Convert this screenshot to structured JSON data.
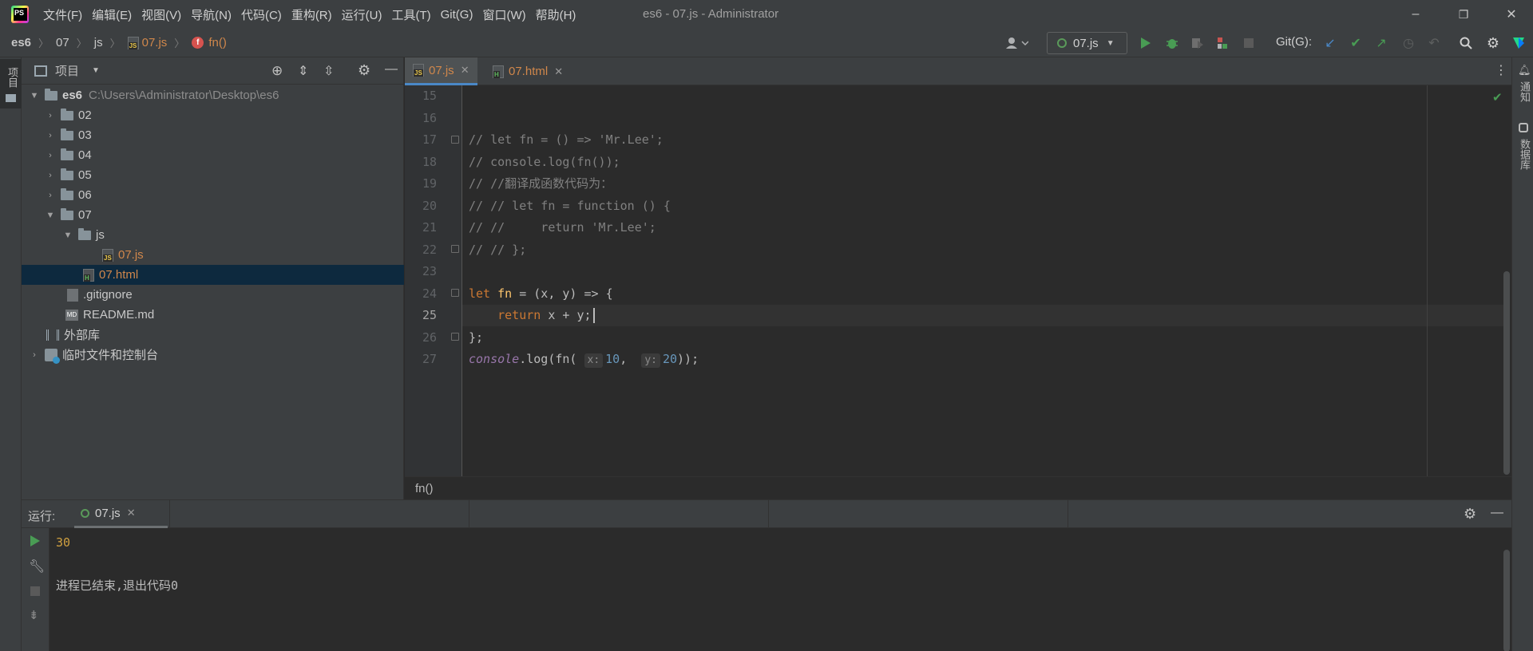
{
  "window": {
    "title": "es6 - 07.js - Administrator",
    "menu": [
      "文件(F)",
      "编辑(E)",
      "视图(V)",
      "导航(N)",
      "代码(C)",
      "重构(R)",
      "运行(U)",
      "工具(T)",
      "Git(G)",
      "窗口(W)",
      "帮助(H)"
    ],
    "controls": {
      "minimize": "–",
      "restore": "❐",
      "close": "✕"
    }
  },
  "navbar": {
    "crumbs": [
      "es6",
      "js",
      "07.js",
      "fn()"
    ],
    "crumb_mid": "07",
    "run_config": "07.js",
    "git_label": "Git(G):",
    "icons": [
      "user-icon",
      "run-icon",
      "debug-icon",
      "coverage-icon",
      "profile-icon",
      "stop-icon",
      "git-update-icon",
      "git-commit-icon",
      "git-push-icon",
      "history-icon",
      "rollback-icon",
      "search-icon",
      "settings-icon",
      "toolbox-icon"
    ]
  },
  "left_strip": {
    "project_label": "项目"
  },
  "project": {
    "title": "项目",
    "root": {
      "name": "es6",
      "path": "C:\\Users\\Administrator\\Desktop\\es6"
    },
    "items": [
      {
        "name": "02"
      },
      {
        "name": "03"
      },
      {
        "name": "04"
      },
      {
        "name": "05"
      },
      {
        "name": "06"
      },
      {
        "name": "07"
      },
      {
        "name": "js"
      },
      {
        "name": "07.js"
      },
      {
        "name": "07.html"
      },
      {
        "name": ".gitignore"
      },
      {
        "name": "README.md"
      },
      {
        "name": "外部库"
      },
      {
        "name": "临时文件和控制台"
      }
    ]
  },
  "editor": {
    "tabs": [
      {
        "label": "07.js",
        "active": true
      },
      {
        "label": "07.html",
        "active": false
      }
    ],
    "line_numbers": [
      "15",
      "16",
      "17",
      "18",
      "19",
      "20",
      "21",
      "22",
      "23",
      "24",
      "25",
      "26",
      "27"
    ],
    "code": {
      "l17": "// let fn = () => 'Mr.Lee';",
      "l18": "// console.log(fn());",
      "l19": "// //翻译成函数代码为：",
      "l20": "// // let fn = function () {",
      "l21": "// //     return 'Mr.Lee';",
      "l22": "// // };",
      "l24_kw": "let",
      "l24_fn": "fn",
      "l24_rest": " = (x, y) => {",
      "l25_kw": "return",
      "l25_rest": " x + y;",
      "l26": "};",
      "l27_console": "console",
      "l27_log": ".log(fn(",
      "l27_hint_x": "x:",
      "l27_val_x": "10",
      "l27_sep": ", ",
      "l27_hint_y": "y:",
      "l27_val_y": "20",
      "l27_end": "));"
    },
    "breadcrumb": "fn()",
    "inspection_status": "✔"
  },
  "right_strip": {
    "notifications": "通知",
    "database": "数据库"
  },
  "run": {
    "label": "运行:",
    "tab": "07.js",
    "output": [
      "30",
      "进程已结束,退出代码0"
    ]
  },
  "colors": {
    "accent": "#4a88c7",
    "selection": "#0d293e",
    "modified_file": "#d0874b"
  }
}
